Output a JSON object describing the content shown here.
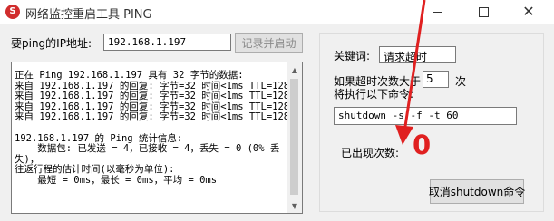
{
  "window": {
    "title": "网络监控重启工具 PING",
    "close_glyph": "✕"
  },
  "form": {
    "ip_label": "要ping的IP地址:",
    "ip_value": "192.168.1.197",
    "record_button": "记录并启动"
  },
  "log": {
    "text": "正在 Ping 192.168.1.197 具有 32 字节的数据:\n来自 192.168.1.197 的回复: 字节=32 时间<1ms TTL=128\n来自 192.168.1.197 的回复: 字节=32 时间<1ms TTL=128\n来自 192.168.1.197 的回复: 字节=32 时间<1ms TTL=128\n来自 192.168.1.197 的回复: 字节=32 时间<1ms TTL=128\n\n192.168.1.197 的 Ping 统计信息:\n    数据包: 已发送 = 4，已接收 = 4，丢失 = 0 (0% 丢\n失)，\n往返行程的估计时间(以毫秒为单位):\n    最短 = 0ms，最长 = 0ms，平均 = 0ms"
  },
  "settings": {
    "keyword_label": "关键词:",
    "keyword_value": "请求超时",
    "times_label_line1": "如果超时次数大于",
    "times_label_line2": "将执行以下命令:",
    "times_value": "5",
    "times_unit": "次",
    "command_value": "shutdown -s -f -t 60",
    "count_label": "已出现次数:",
    "count_value": "0",
    "cancel_button": "取消shutdown命令"
  },
  "colors": {
    "count_value": "#e02020",
    "annotation_arrow": "#e02020"
  }
}
